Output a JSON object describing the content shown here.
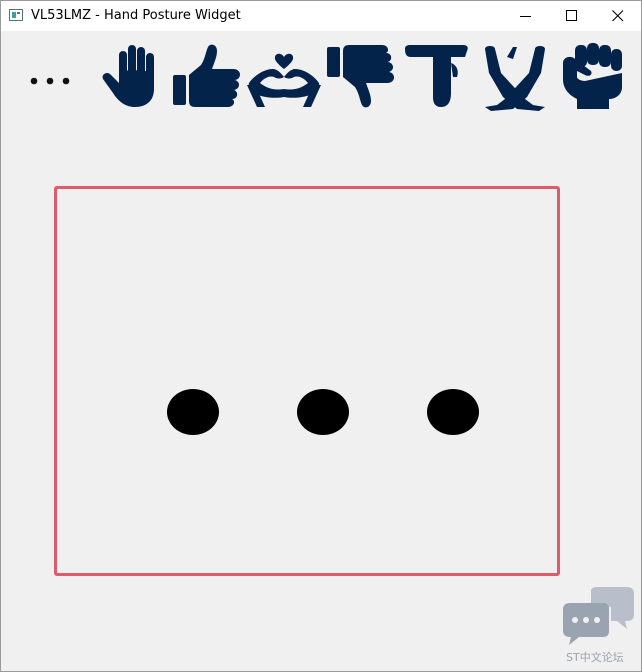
{
  "window": {
    "title": "VL53LMZ - Hand Posture Widget"
  },
  "toolbar": {
    "gestures": [
      {
        "name": "none",
        "icon": "ellipsis-icon"
      },
      {
        "name": "open-hand",
        "icon": "open-hand-icon"
      },
      {
        "name": "thumbs-up",
        "icon": "thumbs-up-icon"
      },
      {
        "name": "heart",
        "icon": "heart-hands-icon"
      },
      {
        "name": "thumbs-down",
        "icon": "thumbs-down-icon"
      },
      {
        "name": "tee",
        "icon": "tee-hand-icon"
      },
      {
        "name": "cross",
        "icon": "cross-hands-icon"
      },
      {
        "name": "fist",
        "icon": "fist-icon"
      }
    ],
    "icon_color": "#03234b"
  },
  "display": {
    "state_icon": "ellipsis-icon",
    "frame_color": "#e05a6a",
    "dot_color": "#000000"
  },
  "watermark": {
    "text": "ST中文论坛",
    "icon": "chat-bubbles-icon"
  }
}
